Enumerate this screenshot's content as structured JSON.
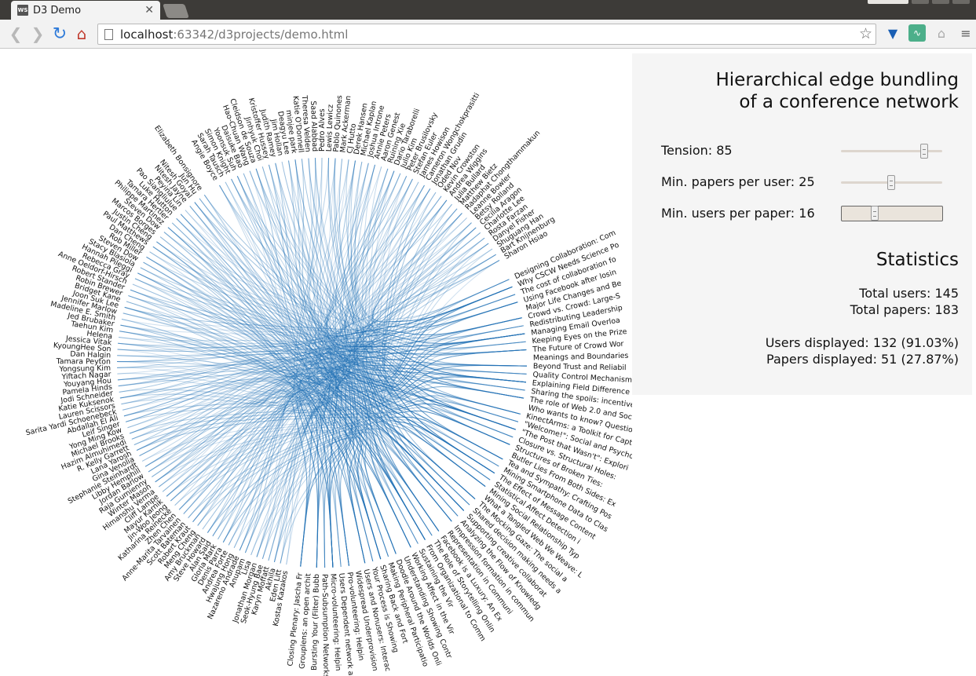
{
  "browser": {
    "tab_title": "D3 Demo",
    "favicon_text": "WS",
    "url_host": "localhost",
    "url_path": ":63342/d3projects/demo.html"
  },
  "panel": {
    "title_line1": "Hierarchical edge bundling",
    "title_line2": "of a conference network",
    "tension_label": "Tension:  85",
    "tension_value": 85,
    "min_papers_label": "Min. papers per user:  25",
    "min_papers_value": 25,
    "min_users_label": "Min. users per paper:  16",
    "min_users_value": 16,
    "stats_title": "Statistics",
    "total_users": "Total users: 145",
    "total_papers": "Total papers: 183",
    "users_displayed": "Users displayed: 132 (91.03%)",
    "papers_displayed": "Papers displayed: 51 (27.87%)"
  },
  "colors": {
    "edge": "#1f6fb4",
    "label": "#111111"
  },
  "users": [
    "Elizabeth Bonsignore",
    "Jun Hu",
    "Nitesh Goyal",
    "Nitesh Jayne",
    "Peyina Lin",
    "Pao Siangliulue",
    "Luke Hutton",
    "Tamara Hertler",
    "Philippe Martinez",
    "Steven Dow",
    "Marcos Borges",
    "Justin Cheng",
    "Paul Matthews",
    "Dan Cheng",
    "Rob Miller",
    "Steven Dow",
    "Stacy Blasiola",
    "Hannah Pileggi",
    "Rebecca Gray",
    "Anne Oeldorf-Hirsch",
    "Robert Stander",
    "Robin Brewer",
    "Bridget Kane",
    "Joon Suk Lee",
    "Jennifer Marlow",
    "Madeline E. Smith",
    "Jed Brubaker",
    "Taehun Kim",
    "Helena",
    "Jessica Vitak",
    "KyoungHee Son",
    "Dan Halgin",
    "Tamara Peyton",
    "Yongsung Kim",
    "Yiftach Nagar",
    "Youyang Hou",
    "Pamela Hinds",
    "Jodi Schneider",
    "Katie Kuksenok",
    "Lauren Scissors",
    "Sarita Yardi Schoenebeck",
    "Abdallah El Ali",
    "Leif Singer",
    "Yong Ming Kow",
    "Michael Brooks",
    "Hazim Almuhimedi",
    "R. Kelly Garrett",
    "Lana Yarosh",
    "Gina Venolia",
    "Stephanie Steinhardt",
    "Libby Hemphill",
    "Jordan Barlow",
    "Raja Gumienny",
    "Winter Mason",
    "Himanshu Verma",
    "Cliff Lampe",
    "Mayur Karnik",
    "Jin-Woo Jeong",
    "Katharina Reinecke",
    "Zhen Chen",
    "Anne-Marita Tarvainen",
    "Scott Bateman",
    "Robert Kraut",
    "Meng Cheng",
    "Amy Bruckman",
    "Steve Howard",
    "Alan Said",
    "Gloria Mark",
    "Denis Parra",
    "Andrea Forte",
    "Hwajung Hong",
    "Nazareno Andrade",
    "Anupam",
    "Lisa",
    "Jonathan Morgan",
    "Seok-Hyung Bae",
    "Karyn Moffatt",
    "Akhila",
    "Eden Litt",
    "Kostas Kazakos"
  ],
  "users_top": [
    "Angie Boyce",
    "Sarah Tausch",
    "Simon Knight",
    "Yoonsuk Suh",
    "Daisuke Bao",
    "Hao-Chuan Wang",
    "Cleidson de Souza",
    "Jinhyuk Choi",
    "Kristoffer Hussey",
    "Judith Ramey",
    "Jim Hollan",
    "Deagyu Lee",
    "minjee park",
    "Katie O'Donnell",
    "Theresa Velden",
    "Saad Alabbad",
    "Pedro Alves",
    "Lewis Lewicz",
    "Pablo Quinones",
    "Mark Ackerman",
    "CJ Hutto",
    "Derek Hansen",
    "Michael Kaplan",
    "Joshua Introne",
    "Annie Peters",
    "Aaron Genest",
    "Ruining Xie",
    "Dario Taraborelli",
    "Julio Kim",
    "Peter Brusilovsky",
    "Stefan Euler",
    "James Howison",
    "Cameron Wongchokprasitti",
    "Jonathan Grudin",
    "Oded Nov",
    "Kevin Crowston",
    "Andrea Wiggins",
    "Julia Bullard",
    "Matthew Bietz",
    "Radaphat Chongthammakun",
    "Leanne Bowler",
    "Betsy Rolland",
    "Cecilia Aragon",
    "Charlotte Lee",
    "Rosta Farzan",
    "Danyel Fisher",
    "Shuguang Han",
    "Bart Knijnenburg",
    "Sharon Hsiao"
  ],
  "papers": [
    "Designing Collaboration: Com",
    "Why CSCW Needs Science Po",
    "The cost of collaboration fo",
    "Using Facebook after losin",
    "Major Life Changes and Be",
    "Crowd vs. Crowd: Large-S",
    "Redistributing Leadership",
    "Managing Email Overloa",
    "Keeping Eyes on the Prize",
    "The Future of Crowd Wor",
    "Meanings and Boundaries",
    "Beyond Trust and Reliabil",
    "Quality Control Mechanism",
    "Explaining Field Difference",
    "Sharing the spoils: incentive",
    "The role of Web 2.0 and Socia",
    "Who wants to know? Question",
    "KinectArms: a Toolkit for Capt",
    "\"Welcome!\": Social and Psycho",
    "\"The Post that Wasn't\": Explori",
    "Closure vs. Structural Holes:",
    "Structures of Broken Ties:",
    "Butler Lies From Both Sides: Ex",
    "Tea and Sympathy: Crafting Pos",
    "Mining Smartphone Data to Clas",
    "The Effect of Message Content",
    "Statistical Affect Detection i",
    "Mining Social Relationship Typ",
    "What a Tangled Web We Weave: L",
    "The Mocking Gaze: The social a",
    "Shared decision making needs a",
    "Supporting creative collaborat",
    "Analyzing the Flow of Knowledg",
    "Impression formation in commun",
    "Representation in Communi",
    "Facebook is a Luxury: An Ex",
    "The Role of Storytelling Onlin",
    "From Organizational to Comm",
    "Sustaining the Vir",
    "Working Affect in the Vir",
    "Understanding Showing Contr",
    "Doodle Around the Worlds Onli",
    "Making Peripheral Participatio",
    "Sharing Back and Fort",
    "Your Process is Showing",
    "Users and Nonusers: Interac",
    "Widespread Underprovision",
    "Pro-volunteering: Helpin",
    "Users Dependent network ana",
    "Micro-volunteering: Helpin",
    "Path-Subsumption Networks",
    "Bursting Your (Filter) Bubb",
    "Grouplens: an open archit",
    "Closing Plenary: Jascha Fr"
  ]
}
